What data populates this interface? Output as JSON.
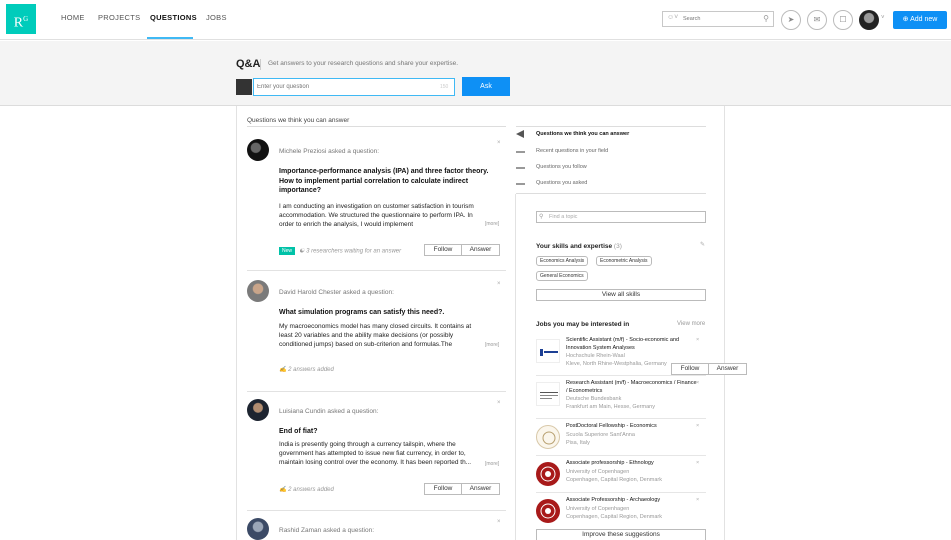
{
  "nav": {
    "logo": "R",
    "logo_sup": "G",
    "links": [
      "HOME",
      "PROJECTS",
      "QUESTIONS",
      "JOBS"
    ],
    "active": "QUESTIONS",
    "search_placeholder": "Search",
    "add_new": "Add new"
  },
  "banner": {
    "title": "Q&A",
    "subtitle": "Get answers to your research questions and share your expertise.",
    "input_placeholder": "Enter your question",
    "char_count": "150",
    "ask_label": "Ask"
  },
  "feed": {
    "title": "Questions we think you can answer",
    "cards": [
      {
        "asker": "Michele Preziosi asked a question:",
        "title": "Importance-performance analysis (IPA) and three factor theory. How to implement partial correlation to calculate indirect importance?",
        "body": "I am conducting an investigation on customer satisfaction in tourism accommodation.  We structured the questionnaire to perform IPA.  In order to enrich the analysis, I would implement",
        "more": "[more]",
        "badge": "New",
        "meta": "3 researchers waiting for an answer",
        "follow": "Follow",
        "answer": "Answer"
      },
      {
        "asker": "David Harold Chester asked a question:",
        "title": "What simulation programs can satisfy this need?.",
        "body": "My macroeconomics model has many closed circuits. It contains at least 20 variables and the ability make decisions (or possibly conditioned jumps) based on sub-criterion and formulas.The",
        "more": "[more]",
        "meta": "2 answers added",
        "follow": "Follow",
        "answer": "Answer"
      },
      {
        "asker": "Luisiana Cundin asked a question:",
        "title": "End of fiat?",
        "body": "India is presently going through a currency tailspin, where the government has attempted to issue new fiat currency, in order to, maintain losing control over the economy. It has been reported th...",
        "more": "[more]",
        "meta": "2 answers added",
        "follow": "Follow",
        "answer": "Answer"
      },
      {
        "asker": "Rashid Zaman asked a question:"
      }
    ]
  },
  "side_nav": [
    "Questions we think you can answer",
    "Recent questions in your field",
    "Questions you follow",
    "Questions you asked"
  ],
  "topics": {
    "placeholder": "Find a topic"
  },
  "skills": {
    "title": "Your skills and expertise",
    "count": "(3)",
    "chips": [
      "Economics Analysis",
      "Econometric Analysis",
      "General Economics"
    ],
    "view_all": "View all skills"
  },
  "jobs": {
    "title": "Jobs you may be interested in",
    "view_more": "View more",
    "items": [
      {
        "title": "Scientific Assistant (m/f) - Socio-economic and Innovation System Analyses",
        "org": "Hochschule Rhein-Waal",
        "loc": "Kleve, North Rhine-Westphalia, Germany"
      },
      {
        "title": "Research Assistant (m/f) - Macroeconomics / Finance / Econometrics",
        "org": "Deutsche Bundesbank",
        "loc": "Frankfurt am Main, Hesse, Germany"
      },
      {
        "title": "PostDoctoral Fellowship - Economics",
        "org": "Scuola Superiore Sant'Anna",
        "loc": "Pisa, Italy"
      },
      {
        "title": "Associate professorship - Ethnology",
        "org": "University of Copenhagen",
        "loc": "Copenhagen, Capital Region, Denmark"
      },
      {
        "title": "Associate Professorship - Archaeology",
        "org": "University of Copenhagen",
        "loc": "Copenhagen, Capital Region, Denmark"
      }
    ],
    "improve": "Improve these suggestions"
  },
  "colors": {
    "accent": "#0e90f5",
    "logo": "#00ccbb",
    "badge": "#00c2a8"
  }
}
